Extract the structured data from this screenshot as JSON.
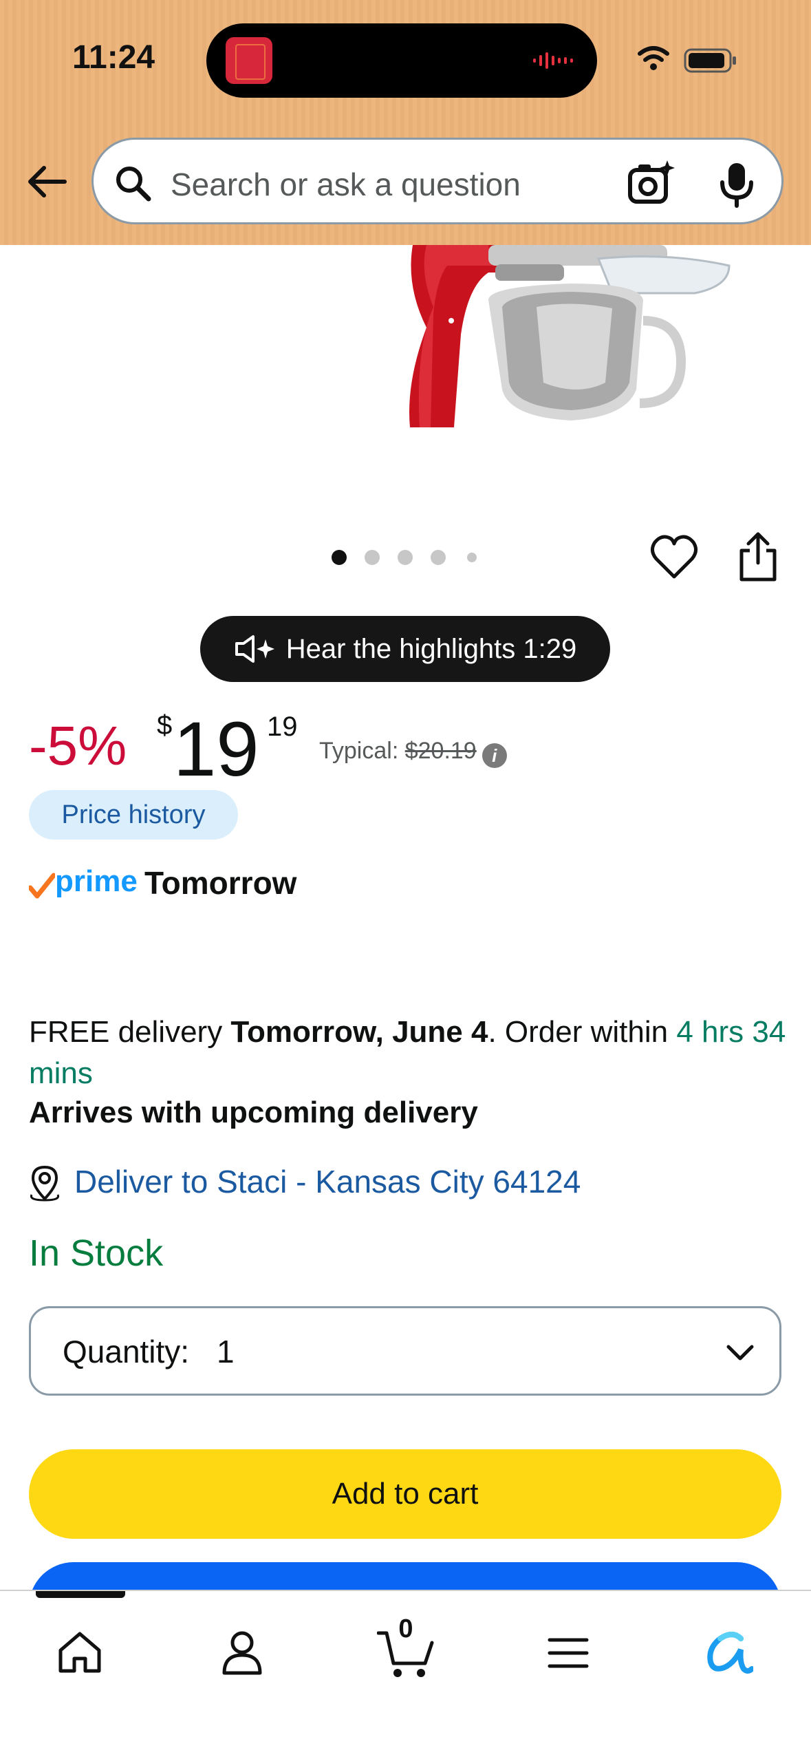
{
  "status_bar": {
    "time": "11:24"
  },
  "search": {
    "placeholder": "Search or ask a question"
  },
  "carousel": {
    "total_dots": 5,
    "active_index": 0
  },
  "audio": {
    "label": "Hear the highlights 1:29"
  },
  "price": {
    "discount": "-5%",
    "currency": "$",
    "whole": "19",
    "fraction": "19",
    "typical_label": "Typical: ",
    "typical_value": "$20.19",
    "history_label": "Price history"
  },
  "prime": {
    "badge": "prime",
    "speed": "Tomorrow"
  },
  "delivery": {
    "prefix": "FREE delivery ",
    "date": "Tomorrow, June 4",
    "middle": ". Order within ",
    "countdown": "4 hrs 34 mins",
    "arrives": "Arrives with upcoming delivery",
    "location": "Deliver to Staci - Kansas City 64124"
  },
  "stock": {
    "status": "In Stock"
  },
  "quantity": {
    "label": "Quantity:",
    "value": "1"
  },
  "actions": {
    "add_to_cart": "Add to cart"
  },
  "tabbar": {
    "cart_count": "0",
    "tabs": [
      "home-icon",
      "account-icon",
      "cart-icon",
      "menu-icon",
      "rufus-icon"
    ]
  },
  "colors": {
    "header_bg": "#ecb67d",
    "discount": "#cc0c39",
    "link": "#1b5aa0",
    "in_stock": "#067d3e",
    "add_to_cart": "#ffd814",
    "buy_now": "#0a65f5",
    "prime": "#1399ff"
  }
}
